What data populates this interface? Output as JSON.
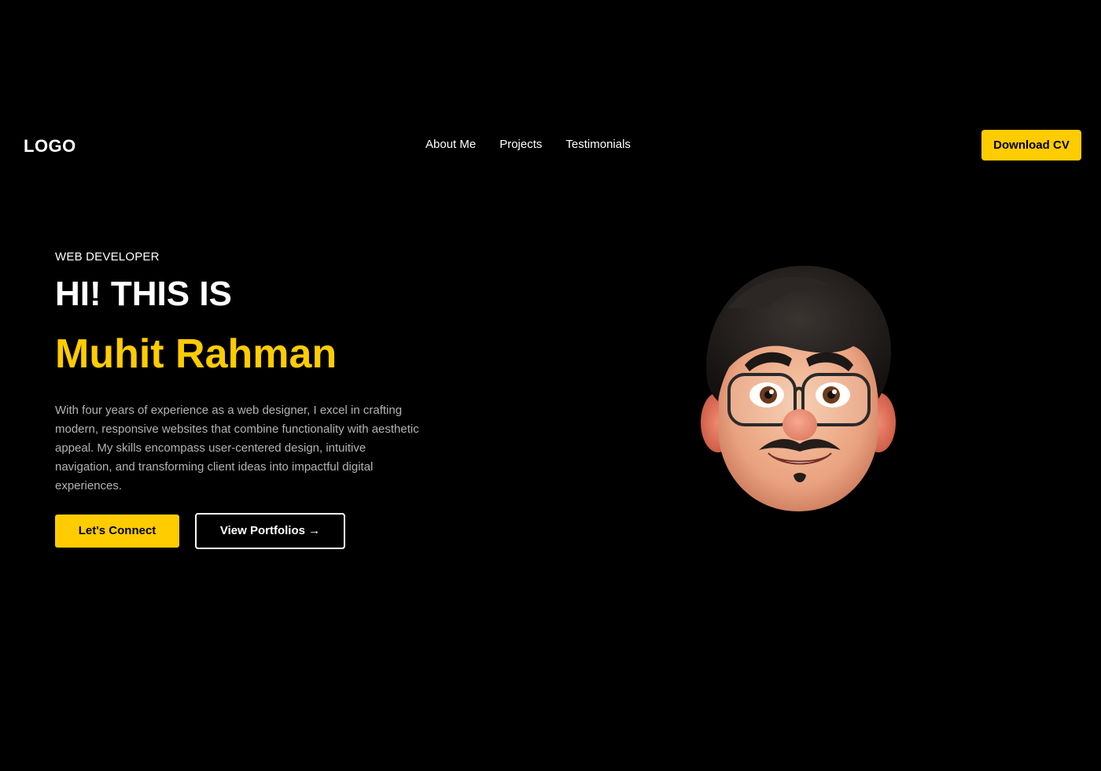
{
  "header": {
    "logo": "LOGO",
    "nav": [
      {
        "label": "About Me"
      },
      {
        "label": "Projects"
      },
      {
        "label": "Testimonials"
      }
    ],
    "cta_label": "Download CV"
  },
  "hero": {
    "eyebrow": "WEB DEVELOPER",
    "greeting": "HI! THIS IS",
    "name": "Muhit Rahman",
    "description": "With four years of experience as a web designer, I excel in crafting modern, responsive websites that combine functionality with aesthetic appeal. My skills encompass user-centered design, intuitive navigation, and transforming client ideas into impactful digital experiences.",
    "primary_button": "Let's Connect",
    "secondary_button": "View Portfolios →"
  },
  "theme": {
    "background": "#000000",
    "accent": "#ffcc00",
    "text": "#ffffff",
    "muted_text": "#b3b3b3"
  },
  "icons": {
    "avatar": "cartoon-man-with-glasses-avatar"
  }
}
